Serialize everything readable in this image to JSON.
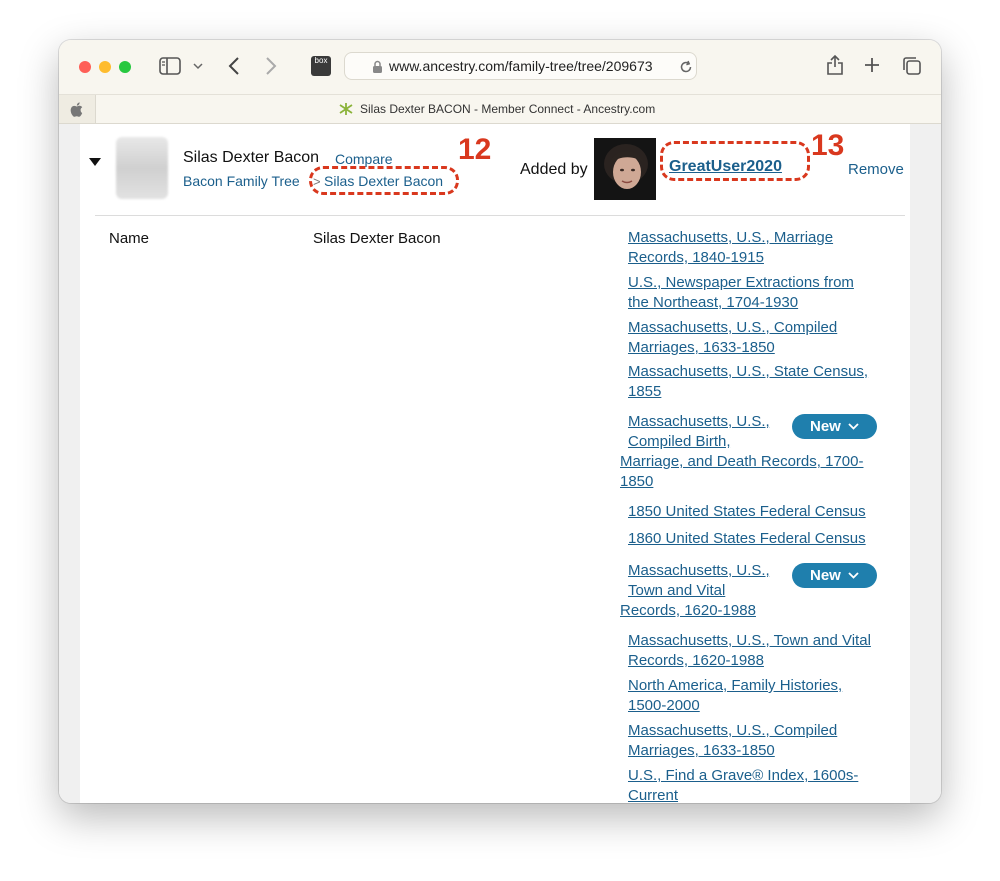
{
  "browser": {
    "url": "www.ancestry.com/family-tree/tree/209673",
    "tab_title": "Silas Dexter BACON - Member Connect - Ancestry.com",
    "box_icon_label": "box"
  },
  "header": {
    "person_name": "Silas Dexter Bacon",
    "compare_label": "Compare",
    "tree_name": "Bacon Family Tree",
    "person_link": "Silas Dexter Bacon",
    "added_by_label": "Added by",
    "user_name": "GreatUser2020",
    "remove_label": "Remove"
  },
  "annotations": {
    "a12": "12",
    "a13": "13"
  },
  "detail": {
    "field_label": "Name",
    "field_value": "Silas Dexter Bacon"
  },
  "records": [
    {
      "line1": "Massachusetts, U.S., Marriage",
      "line2": "Records, 1840-1915"
    },
    {
      "line1": "U.S., Newspaper Extractions from",
      "line2": "the Northeast, 1704-1930"
    },
    {
      "line1": "Massachusetts, U.S., Compiled",
      "line2": "Marriages, 1633-1850"
    },
    {
      "line1": "Massachusetts, U.S., State Census,",
      "line2": "1855"
    },
    {
      "line1": "Massachusetts, U.S.,",
      "line2": "Compiled Birth,",
      "line3": "Marriage, and Death Records, 1700-",
      "line4": "1850",
      "badge": "New"
    },
    {
      "line1": "1850 United States Federal Census"
    },
    {
      "line1": "1860 United States Federal Census"
    },
    {
      "line1": "Massachusetts, U.S.,",
      "line2": "Town and Vital",
      "line3": "Records, 1620-1988",
      "badge": "New"
    },
    {
      "line1": "Massachusetts, U.S., Town and Vital",
      "line2": "Records, 1620-1988"
    },
    {
      "line1": "North America, Family Histories,",
      "line2": "1500-2000"
    },
    {
      "line1": "Massachusetts, U.S., Compiled",
      "line2": "Marriages, 1633-1850"
    },
    {
      "line1": "U.S., Find a Grave® Index, 1600s-",
      "line2": "Current"
    }
  ]
}
